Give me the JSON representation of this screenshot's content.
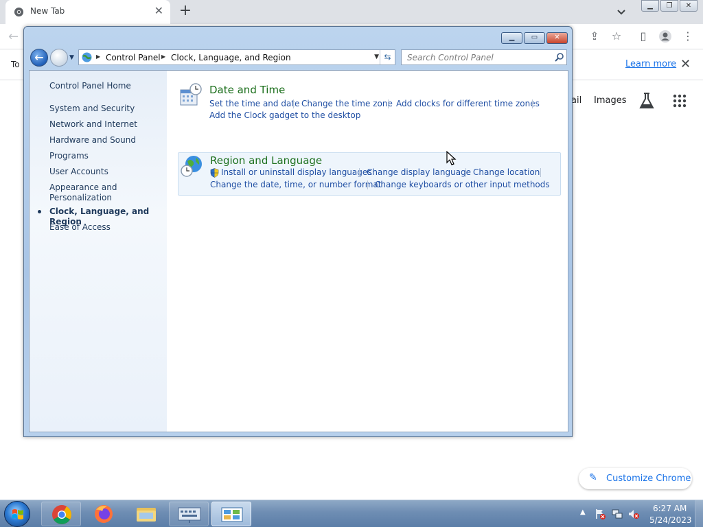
{
  "browser": {
    "tab_title": "New Tab",
    "tab_close": "✕",
    "new_tab": "+",
    "infobar_text": "To",
    "learn_more": "Learn more",
    "google_links": [
      "ail",
      "Images"
    ],
    "customize_label": "Customize Chrome",
    "accent": "#1a73e8"
  },
  "control_panel": {
    "breadcrumb": [
      "Control Panel",
      "Clock, Language, and Region"
    ],
    "search_placeholder": "Search Control Panel",
    "sidebar": {
      "home": "Control Panel Home",
      "items": [
        "System and Security",
        "Network and Internet",
        "Hardware and Sound",
        "Programs",
        "User Accounts",
        "Appearance and",
        "Personalization",
        "Clock, Language, and Region",
        "Ease of Access"
      ]
    },
    "categories": [
      {
        "title": "Date and Time",
        "links": [
          "Set the time and date",
          "Change the time zone",
          "Add clocks for different time zones",
          "Add the Clock gadget to the desktop"
        ]
      },
      {
        "title": "Region and Language",
        "links": [
          "Install or uninstall display languages",
          "Change display language",
          "Change location",
          "Change the date, time, or number format",
          "Change keyboards or other input methods"
        ]
      }
    ],
    "title_color": "#1c6f1c",
    "link_color": "#1f4ea3"
  },
  "taskbar": {
    "apps": [
      "chrome-icon",
      "firefox-icon",
      "file-explorer-icon",
      "on-screen-keyboard-icon",
      "control-panel-icon"
    ],
    "clock_time": "6:27 AM",
    "clock_date": "5/24/2023"
  }
}
